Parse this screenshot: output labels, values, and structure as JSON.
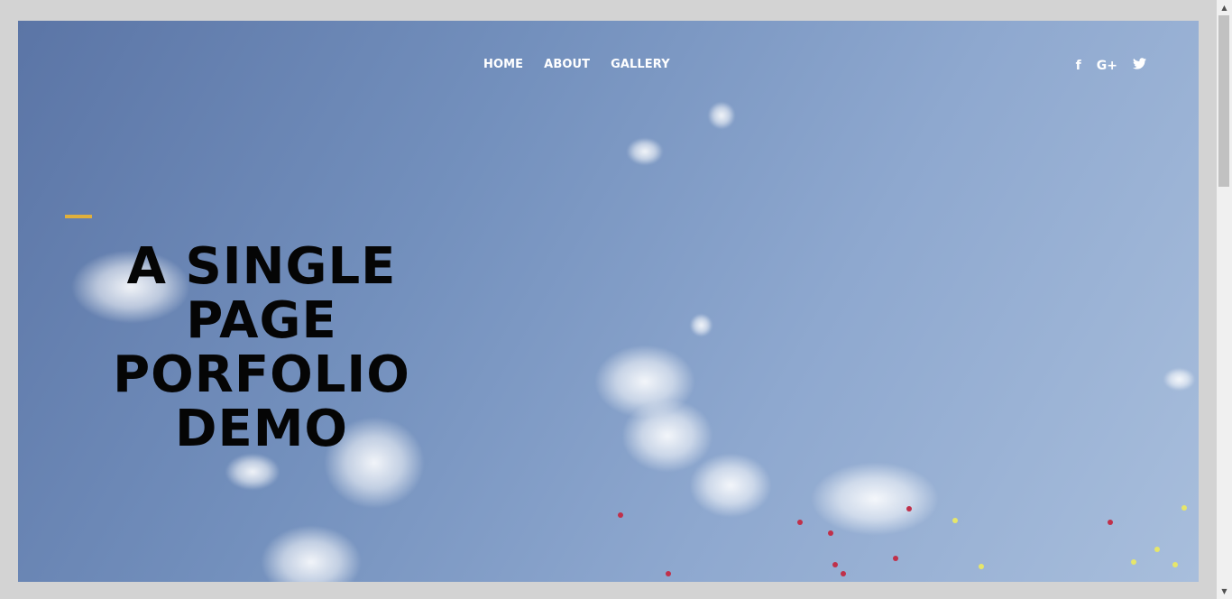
{
  "nav": {
    "items": [
      {
        "label": "HOME"
      },
      {
        "label": "ABOUT"
      },
      {
        "label": "GALLERY"
      }
    ]
  },
  "social": {
    "facebook": "f",
    "google_plus": "G+",
    "twitter": "🐦"
  },
  "hero": {
    "title_lines": [
      "A SINGLE",
      "PAGE",
      "PORFOLIO",
      "DEMO"
    ]
  },
  "colors": {
    "accent": "#e0b03c",
    "sky_dark": "#5b75a6",
    "sky_light": "#a8bedc",
    "headline": "#050505"
  },
  "icons": [
    "facebook-icon",
    "google-plus-icon",
    "twitter-icon",
    "scroll-up-icon",
    "scroll-down-icon"
  ]
}
